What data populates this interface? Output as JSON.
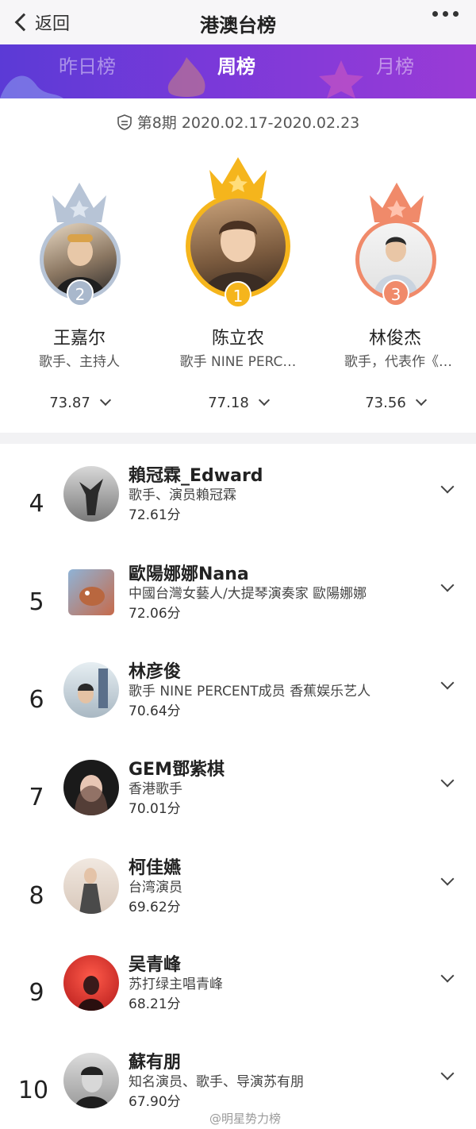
{
  "nav": {
    "back_label": "返回",
    "title": "港澳台榜"
  },
  "tabs": [
    {
      "label": "昨日榜",
      "active": false
    },
    {
      "label": "周榜",
      "active": true
    },
    {
      "label": "月榜",
      "active": false
    }
  ],
  "period": {
    "text": "第8期  2020.02.17-2020.02.23"
  },
  "podium": [
    {
      "rank": "2",
      "name": "王嘉尔",
      "desc": "歌手、主持人",
      "score": "73.87"
    },
    {
      "rank": "1",
      "name": "陈立农",
      "desc": "歌手 NINE PERC…",
      "score": "77.18"
    },
    {
      "rank": "3",
      "name": "林俊杰",
      "desc": "歌手，代表作《…",
      "score": "73.56"
    }
  ],
  "list": [
    {
      "rank": "4",
      "name": "賴冠霖_Edward",
      "desc": "歌手、演员賴冠霖",
      "score": "72.61分"
    },
    {
      "rank": "5",
      "name": "歐陽娜娜Nana",
      "desc": "中國台灣女藝人/大提琴演奏家 歐陽娜娜",
      "score": "72.06分"
    },
    {
      "rank": "6",
      "name": "林彦俊",
      "desc": "歌手 NINE PERCENT成员 香蕉娱乐艺人",
      "score": "70.64分"
    },
    {
      "rank": "7",
      "name": "GEM鄧紫棋",
      "desc": "香港歌手",
      "score": "70.01分"
    },
    {
      "rank": "8",
      "name": "柯佳嬿",
      "desc": "台湾演员",
      "score": "69.62分"
    },
    {
      "rank": "9",
      "name": "吴青峰",
      "desc": "苏打绿主唱青峰",
      "score": "68.21分"
    },
    {
      "rank": "10",
      "name": "蘇有朋",
      "desc": "知名演员、歌手、导演苏有朋",
      "score": "67.90分"
    }
  ],
  "watermark": "@明星势力榜",
  "colors": {
    "gold": "#f5b51c",
    "silver": "#b7c4d6",
    "bronze": "#f08a6a",
    "tab_bar": "#7a39d9"
  }
}
